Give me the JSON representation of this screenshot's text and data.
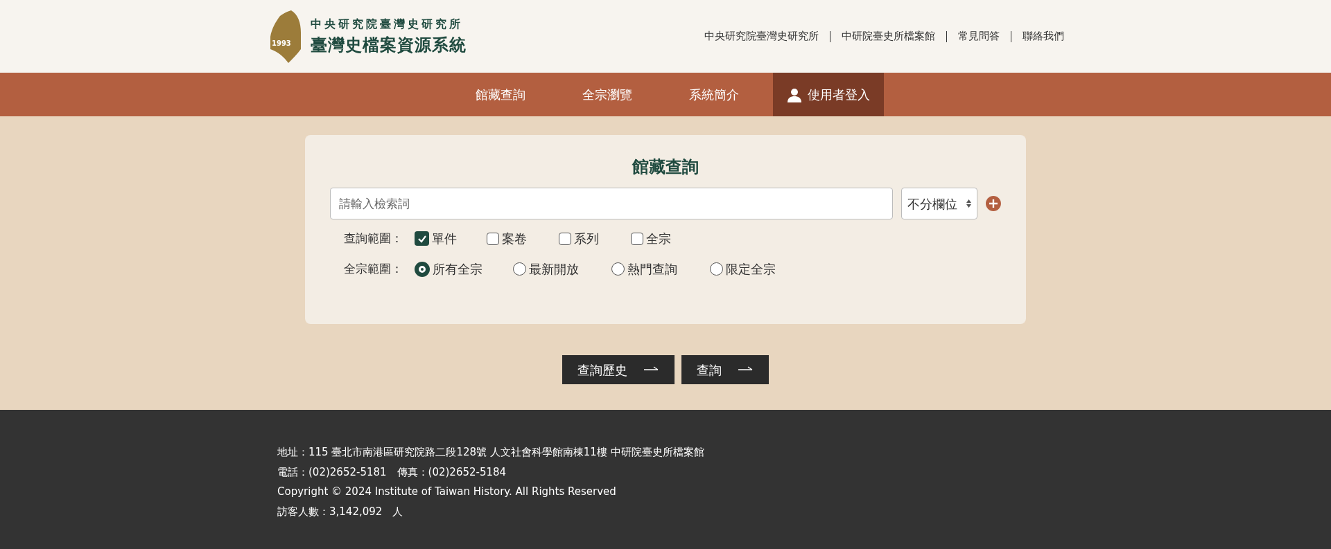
{
  "header": {
    "logo_year": "1993",
    "org_name": "中央研究院臺灣史研究所",
    "site_title": "臺灣史檔案資源系統",
    "top_links": [
      "中央研究院臺灣史研究所",
      "中研院臺史所檔案館",
      "常見問答",
      "聯絡我們"
    ]
  },
  "nav": [
    {
      "label": "館藏查詢",
      "kind": "link"
    },
    {
      "label": "全宗瀏覽",
      "kind": "link"
    },
    {
      "label": "系統簡介",
      "kind": "link"
    },
    {
      "label": "使用者登入",
      "kind": "login"
    }
  ],
  "search": {
    "title": "館藏查詢",
    "placeholder": "請輸入檢索詞",
    "field_select": "不分欄位",
    "scope": {
      "label": "查詢範圍：",
      "options": [
        {
          "label": "單件",
          "checked": true
        },
        {
          "label": "案卷",
          "checked": false
        },
        {
          "label": "系列",
          "checked": false
        },
        {
          "label": "全宗",
          "checked": false
        }
      ]
    },
    "fonds": {
      "label": "全宗範圍：",
      "options": [
        {
          "label": "所有全宗",
          "selected": true
        },
        {
          "label": "最新開放",
          "selected": false
        },
        {
          "label": "熱門查詢",
          "selected": false
        },
        {
          "label": "限定全宗",
          "selected": false
        }
      ]
    },
    "buttons": [
      "查詢歷史",
      "查詢"
    ]
  },
  "footer": {
    "lines": [
      "地址：115 臺北市南港區研究院路二段128號 人文社會科學館南棟11樓 中研院臺史所檔案館",
      "電話：(02)2652-5181　傳真：(02)2652-5184",
      "Copyright © 2024 Institute of Taiwan History. All Rights Reserved",
      "訪客人數：3,142,092　人"
    ]
  }
}
